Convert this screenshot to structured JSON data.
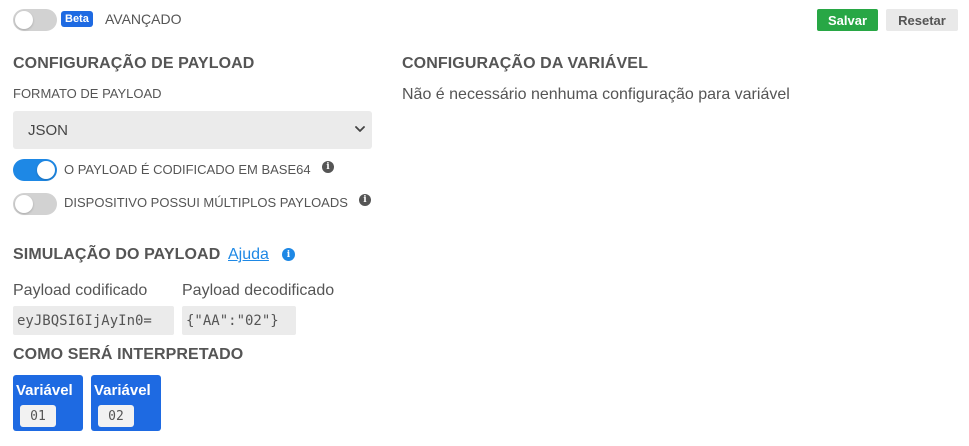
{
  "header": {
    "beta_badge": "Beta",
    "advanced_label": "AVANÇADO",
    "advanced_enabled": false,
    "save_label": "Salvar",
    "reset_label": "Resetar"
  },
  "payload_config": {
    "title": "CONFIGURAÇÃO DE PAYLOAD",
    "format_label": "FORMATO DE PAYLOAD",
    "format_value": "JSON",
    "base64_label": "O PAYLOAD É CODIFICADO EM BASE64",
    "base64_enabled": true,
    "multi_label": "DISPOSITIVO POSSUI MÚLTIPLOS PAYLOADS",
    "multi_enabled": false
  },
  "variable_config": {
    "title": "CONFIGURAÇÃO DA VARIÁVEL",
    "message": "Não é necessário nenhuma configuração para variável"
  },
  "simulation": {
    "title": "SIMULAÇÃO DO PAYLOAD",
    "help_link": "Ajuda",
    "encoded_label": "Payload codificado",
    "encoded_value": "eyJBQSI6IjAyIn0=",
    "decoded_label": "Payload decodificado",
    "decoded_value": "{\"AA\":\"02\"}"
  },
  "interpretation": {
    "title": "COMO SERÁ INTERPRETADO",
    "variables": [
      {
        "label": "Variável",
        "value": "01"
      },
      {
        "label": "Variável",
        "value": "02"
      }
    ]
  },
  "colors": {
    "accent_blue": "#1e88e5",
    "card_blue": "#1e6ae2",
    "save_green": "#28a745"
  }
}
